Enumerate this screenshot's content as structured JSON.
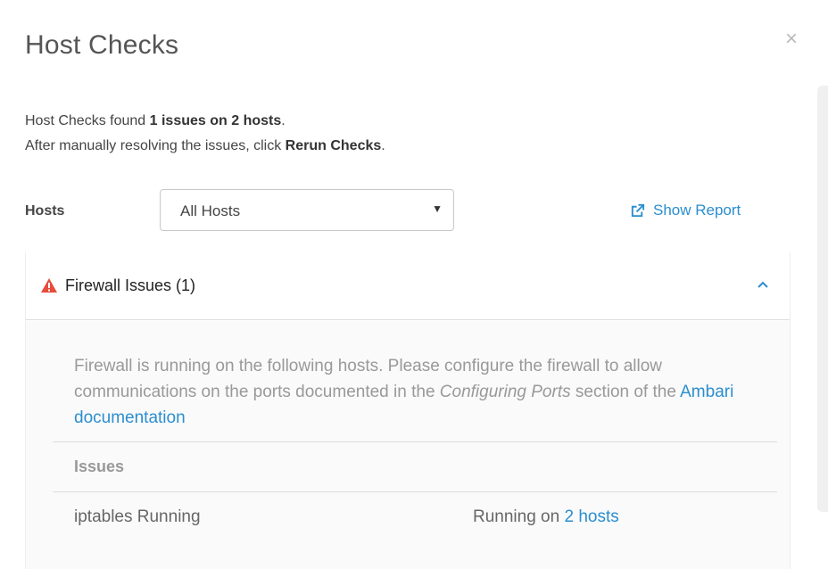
{
  "modal": {
    "title": "Host Checks",
    "close_glyph": "×"
  },
  "summary": {
    "line1_prefix": "Host Checks found ",
    "line1_bold": "1 issues on 2 hosts",
    "line1_suffix": ".",
    "line2_prefix": "After manually resolving the issues, click ",
    "line2_bold": "Rerun Checks",
    "line2_suffix": "."
  },
  "filter": {
    "label": "Hosts",
    "selected": "All Hosts",
    "caret_glyph": "▼"
  },
  "report": {
    "label": "Show Report",
    "icon": "external-link-icon"
  },
  "panel": {
    "title": "Firewall Issues (1)",
    "warning_icon": "warning-triangle-icon",
    "toggle_icon": "chevron-up-icon",
    "expanded": true,
    "description": {
      "text1": "Firewall is running on the following hosts. Please configure the firewall to allow communications on the ports documented in the ",
      "italic": "Configuring Ports",
      "text2": " section of the ",
      "link": "Ambari documentation"
    },
    "table": {
      "header": "Issues",
      "rows": [
        {
          "issue": "iptables Running",
          "status_prefix": "Running on ",
          "status_link": "2 hosts"
        }
      ]
    }
  },
  "colors": {
    "link": "#2b8ecf",
    "warning": "#e74c3c",
    "muted_text": "#999999"
  }
}
